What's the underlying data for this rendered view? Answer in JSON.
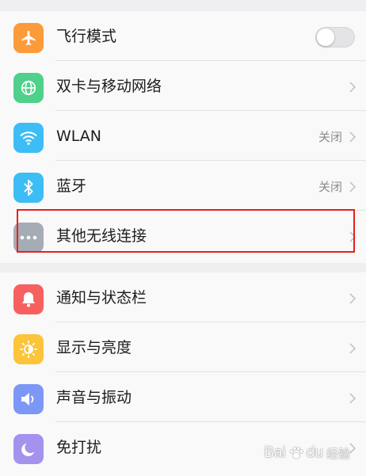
{
  "groups": [
    {
      "items": [
        {
          "label": "飞行模式",
          "icon": "airplane-icon",
          "icon_color": "#fb9b39",
          "control": "toggle",
          "toggle_on": false
        },
        {
          "label": "双卡与移动网络",
          "icon": "globe-icon",
          "icon_color": "#4fd08b",
          "control": "chevron"
        },
        {
          "label": "WLAN",
          "icon": "wifi-icon",
          "icon_color": "#3dbdf5",
          "control": "chevron",
          "status": "关闭"
        },
        {
          "label": "蓝牙",
          "icon": "bluetooth-icon",
          "icon_color": "#3dbdf5",
          "control": "chevron",
          "status": "关闭"
        },
        {
          "label": "其他无线连接",
          "icon": "more-dots-icon",
          "icon_color": "#a6acb6",
          "control": "chevron",
          "highlighted": true
        }
      ]
    },
    {
      "items": [
        {
          "label": "通知与状态栏",
          "icon": "bell-icon",
          "icon_color": "#f86060",
          "control": "chevron"
        },
        {
          "label": "显示与亮度",
          "icon": "brightness-icon",
          "icon_color": "#fbc43a",
          "control": "chevron"
        },
        {
          "label": "声音与振动",
          "icon": "speaker-icon",
          "icon_color": "#7d97f6",
          "control": "chevron"
        },
        {
          "label": "免打扰",
          "icon": "moon-icon",
          "icon_color": "#a592ee",
          "control": "chevron"
        }
      ]
    }
  ],
  "highlight_color": "#e8201c",
  "watermark": {
    "brand": "Bai",
    "brand_end": "du",
    "sub": "经验"
  }
}
